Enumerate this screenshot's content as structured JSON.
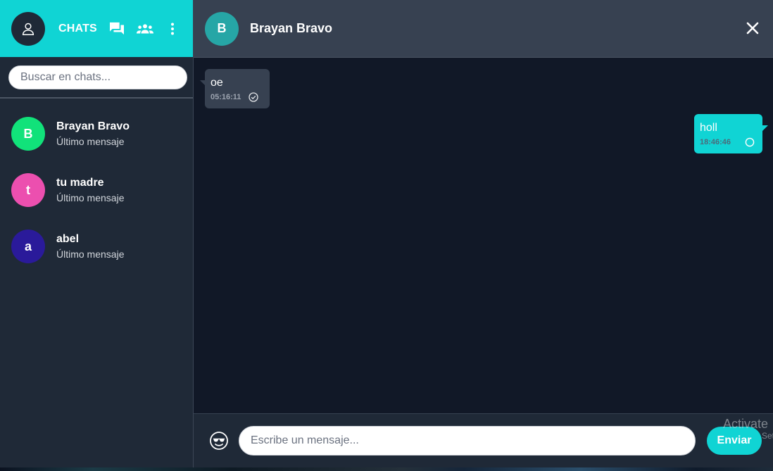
{
  "sidebar": {
    "title": "CHATS",
    "icons": {
      "profile": "user-icon",
      "chats": "chat-bubbles-icon",
      "groups": "group-icon",
      "menu": "more-vertical-icon"
    },
    "search": {
      "placeholder": "Buscar en chats...",
      "value": ""
    },
    "chats": [
      {
        "initial": "B",
        "name": "Brayan Bravo",
        "last": "Último mensaje",
        "color": "#11e27a"
      },
      {
        "initial": "t",
        "name": "tu madre",
        "last": "Último mensaje",
        "color": "#ec4faf"
      },
      {
        "initial": "a",
        "name": "abel",
        "last": "Último mensaje",
        "color": "#2a1a9a"
      }
    ]
  },
  "conversation": {
    "avatar_initial": "B",
    "name": "Brayan Bravo",
    "close_icon": "close-icon",
    "messages": [
      {
        "direction": "in",
        "text": "oe",
        "time": "05:16:11",
        "status_icon": "check-circle-icon"
      },
      {
        "direction": "out",
        "text": "holl",
        "time": "18:46:46",
        "status_icon": "pending-circle-icon"
      }
    ],
    "composer": {
      "emoji_icon": "emoji-sunglasses-icon",
      "placeholder": "Escribe un mensaje...",
      "value": "",
      "send_label": "Enviar"
    }
  },
  "watermark": {
    "line1": "Activate",
    "line2": "Setti"
  },
  "colors": {
    "accent": "#10d4d4",
    "sidebar_bg": "#1f2937",
    "chat_bg": "#111827",
    "header_bg": "#374151"
  }
}
